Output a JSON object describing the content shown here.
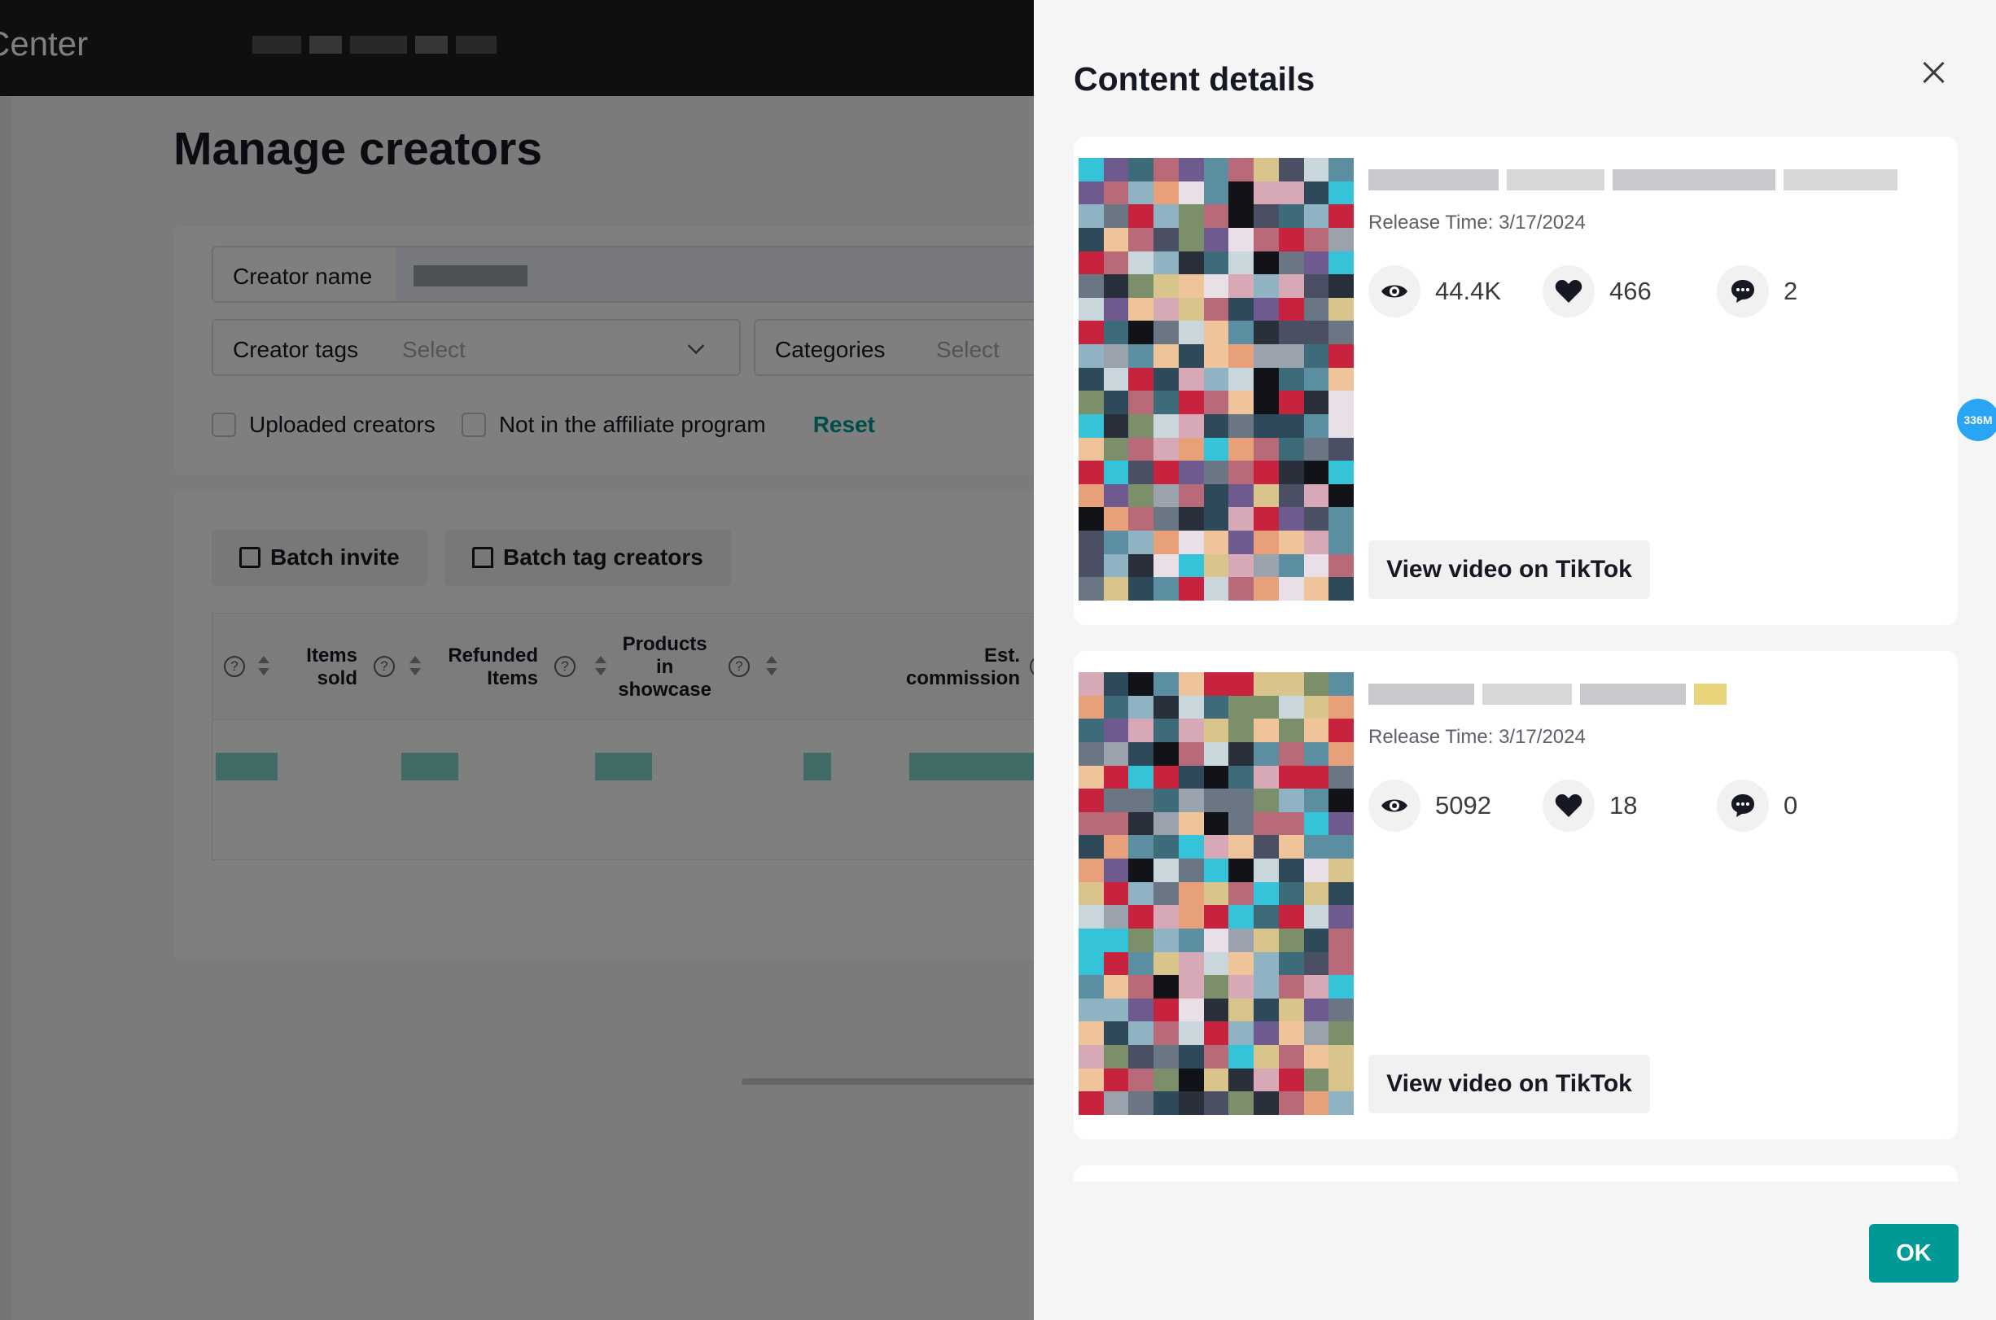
{
  "app": {
    "brand_partial": "Center"
  },
  "page": {
    "title": "Manage creators",
    "filters": {
      "creator_name_label": "Creator name",
      "creator_tags_label": "Creator tags",
      "creator_tags_placeholder": "Select",
      "categories_label": "Categories",
      "categories_placeholder": "Select",
      "uploaded_creators_label": "Uploaded creators",
      "not_in_affiliate_label": "Not in the affiliate program",
      "reset_label": "Reset"
    },
    "actions": {
      "batch_invite_label": "Batch invite",
      "batch_tag_label": "Batch tag creators"
    },
    "table": {
      "columns": [
        "Items sold",
        "Refunded Items",
        "Products in showcase",
        "Est. commission"
      ],
      "col_items_sold": "Items\nsold",
      "col_refunded": "Refunded\nItems",
      "col_showcase": "Products\nin\nshowcase",
      "col_commission": "Est.\ncommission"
    }
  },
  "drawer": {
    "title": "Content details",
    "videos": [
      {
        "release_time": "Release Time: 3/17/2024",
        "views": "44.4K",
        "likes": "466",
        "comments": "2",
        "button_label": "View video on TikTok"
      },
      {
        "release_time": "Release Time: 3/17/2024",
        "views": "5092",
        "likes": "18",
        "comments": "0",
        "button_label": "View video on TikTok"
      }
    ],
    "ok_label": "OK"
  },
  "floating_badge": "336M",
  "colors": {
    "accent": "#009995",
    "topbar": "#1e1f23",
    "badge": "#2aa4f4"
  },
  "icons": {
    "views": "eye-icon",
    "likes": "heart-icon",
    "comments": "comment-icon",
    "close": "close-icon"
  }
}
